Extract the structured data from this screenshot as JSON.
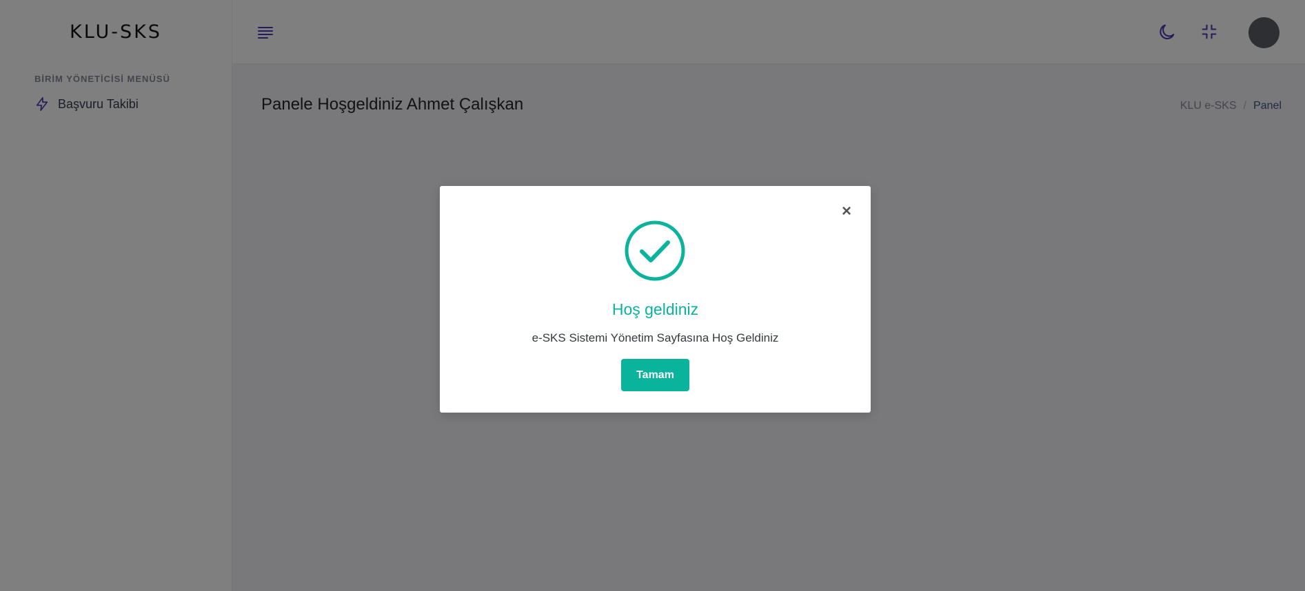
{
  "brand": {
    "name": "KLU-SKS"
  },
  "sidebar": {
    "menu_title": "BİRİM YÖNETİCİSİ MENÜSÜ",
    "items": [
      {
        "label": "Başvuru Takibi",
        "icon": "lightning-icon"
      }
    ]
  },
  "topbar": {
    "icons": [
      "hamburger-icon",
      "moon-icon",
      "fullscreen-exit-icon",
      "avatar"
    ]
  },
  "page": {
    "title": "Panele Hoşgeldiniz Ahmet Çalışkan",
    "breadcrumb": [
      {
        "label": "KLU e-SKS"
      },
      {
        "label": "Panel"
      }
    ],
    "breadcrumb_separator": "/"
  },
  "modal": {
    "title": "Hoş geldiniz",
    "text": "e-SKS Sistemi Yönetim Sayfasına Hoş Geldiniz",
    "confirm_label": "Tamam",
    "close_label": "×",
    "icon": "check-circle-icon"
  },
  "colors": {
    "accent": "#405189",
    "success": "#0ab39c",
    "icon": "#4b38b3"
  }
}
